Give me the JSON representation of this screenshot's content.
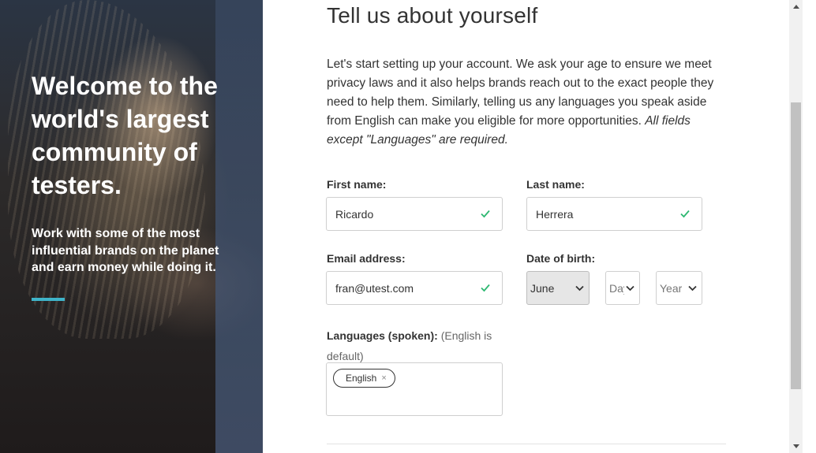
{
  "hero": {
    "title": "Welcome to the world's largest community of testers.",
    "subtitle": "Work with some of the most influential brands on the planet and earn money while doing it.",
    "accent_color": "#3fb4c9"
  },
  "form": {
    "title": "Tell us about yourself",
    "intro": "Let's start setting up your account. We ask your age to ensure we meet privacy laws and it also helps brands reach out to the exact people they need to help them. Similarly, telling us any languages you speak aside from English can make you eligible for more opportunities.",
    "intro_note": "All fields except \"Languages\" are required.",
    "first_name": {
      "label": "First name:",
      "value": "Ricardo"
    },
    "last_name": {
      "label": "Last name:",
      "value": "Herrera"
    },
    "email": {
      "label": "Email address:",
      "value": "fran@utest.com"
    },
    "dob": {
      "label": "Date of birth:",
      "month": "June",
      "day": "Day",
      "year": "Year"
    },
    "languages": {
      "label": "Languages (spoken):",
      "hint": "(English is default)",
      "tags": [
        "English"
      ],
      "remove_glyph": "×"
    },
    "valid_color": "#2eb872"
  }
}
